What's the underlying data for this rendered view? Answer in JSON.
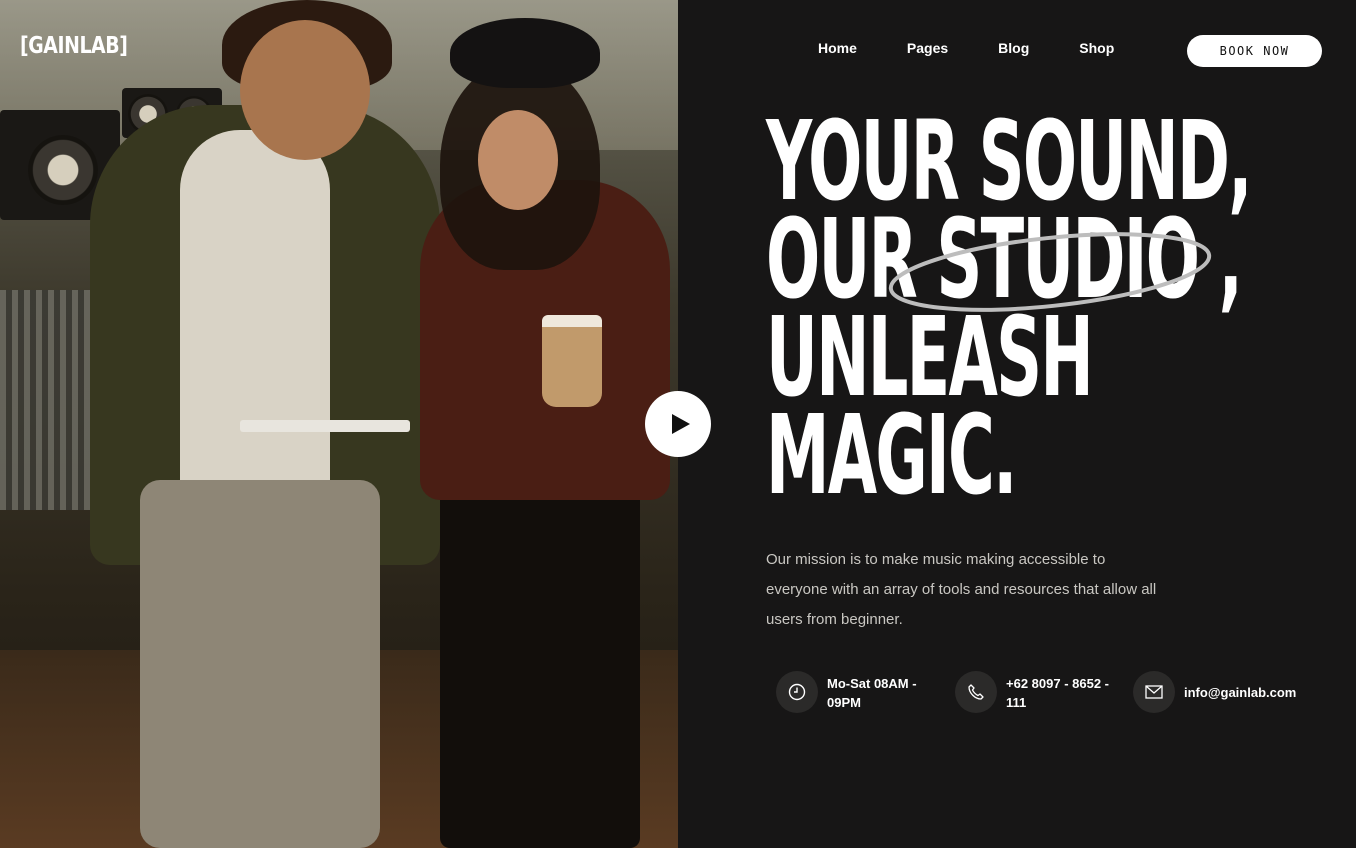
{
  "brand": {
    "logo": "[GAINLAB]"
  },
  "nav": {
    "items": [
      "Home",
      "Pages",
      "Blog",
      "Shop"
    ],
    "cta": "BOOK NOW"
  },
  "hero": {
    "headline_lines": [
      "YOUR SOUND,",
      "OUR STUDIO ,",
      "UNLEASH",
      "MAGIC."
    ],
    "mission": "Our mission is to make music making accessible to everyone with an array of tools and resources that allow all users from beginner."
  },
  "contacts": [
    {
      "icon": "clock-icon",
      "text": "Mo-Sat 08AM - 09PM"
    },
    {
      "icon": "phone-icon",
      "text": "+62 8097 - 8652 - 111"
    },
    {
      "icon": "mail-icon",
      "text": "info@gainlab.com"
    }
  ],
  "colors": {
    "background": "#171616",
    "text": "#ffffff",
    "button_bg": "#ffffff"
  }
}
